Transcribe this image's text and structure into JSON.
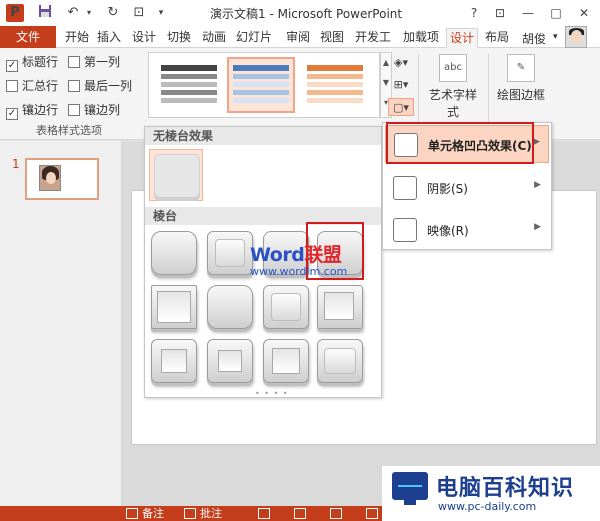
{
  "titlebar": {
    "app_icon": "P",
    "title": "演示文稿1 - Microsoft PowerPoint",
    "help": "?",
    "ribbon_display": "⊡",
    "minimize": "—",
    "maximize": "□",
    "close": "✕"
  },
  "tabs": [
    "文件",
    "开始",
    "插入",
    "设计",
    "切换",
    "动画",
    "幻灯片",
    "审阅",
    "视图",
    "开发工",
    "加载项",
    "设计",
    "布局"
  ],
  "user": {
    "name": "胡俊"
  },
  "table_style_options": {
    "items": [
      {
        "label": "标题行",
        "checked": true
      },
      {
        "label": "第一列",
        "checked": false
      },
      {
        "label": "汇总行",
        "checked": false
      },
      {
        "label": "最后一列",
        "checked": false
      },
      {
        "label": "镶边行",
        "checked": true
      },
      {
        "label": "镶边列",
        "checked": false
      }
    ],
    "group_label": "表格样式选项"
  },
  "ribbon_buttons": {
    "wordart": "艺术字样式",
    "wordart_icon_text": "abc",
    "draw_borders": "绘图边框"
  },
  "bevel_menu": {
    "no_bevel_header": "无棱台效果",
    "bevel_header": "棱台"
  },
  "submenu": {
    "items": [
      {
        "label": "单元格凹凸效果(C)",
        "highlighted": true
      },
      {
        "label": "阴影(S)",
        "highlighted": false
      },
      {
        "label": "映像(R)",
        "highlighted": false
      }
    ]
  },
  "slides": {
    "thumb_number": "1"
  },
  "watermark": {
    "title_en": "Word",
    "title_cn": "联盟",
    "url": "www.wordlm.com"
  },
  "statusbar": {
    "notes": "备注",
    "comments": "批注"
  },
  "site_logo": {
    "name": "电脑百科知识",
    "url": "www.pc-daily.com"
  },
  "colors": {
    "accent": "#c43e1c",
    "highlight": "#fbd5c2",
    "red_box": "#d01c1c"
  }
}
